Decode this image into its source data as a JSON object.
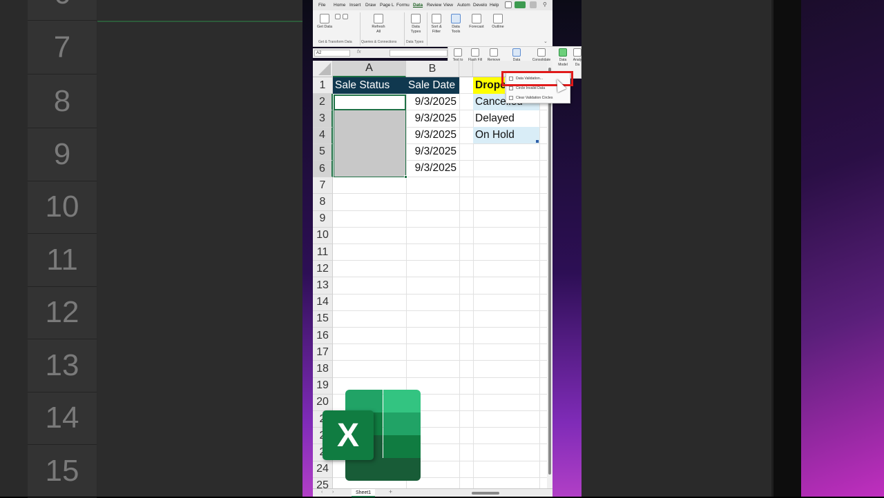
{
  "ribbon": {
    "tabs": [
      "File",
      "Home",
      "Insert",
      "Draw",
      "Page L",
      "Formu",
      "Data",
      "Review",
      "View",
      "Autom",
      "Develo",
      "Help"
    ],
    "active_tab": "Data",
    "buttons": {
      "get_data": "Get Data",
      "refresh_all": "Refresh All",
      "data_types": "Data Types",
      "sort_filter": "Sort & Filter",
      "data_tools": "Data Tools",
      "forecast": "Forecast",
      "outline": "Outline"
    },
    "groups": [
      "Get & Transform Data",
      "Queries & Connections",
      "Data Types"
    ]
  },
  "formula_bar": {
    "name_box": "A2",
    "fx": "fx"
  },
  "data_tools": {
    "text_to_columns": "Text to Columns",
    "flash_fill": "Flash Fill",
    "remove_duplicates": "Remove Duplicates",
    "data_validation": "Data Validation",
    "consolidate": "Consolidate",
    "data_model": "Data Model",
    "analysis": "Analy Da"
  },
  "dropdown_menu": {
    "items": [
      "Data Validation...",
      "Circle Invalid Data",
      "Clear Validation Circles"
    ],
    "highlighted": "Data Validation..."
  },
  "grid": {
    "columns": [
      "A",
      "B"
    ],
    "row_numbers": [
      "1",
      "2",
      "3",
      "4",
      "5",
      "6",
      "7",
      "8",
      "9",
      "10",
      "11",
      "12",
      "13",
      "14",
      "15",
      "16",
      "17",
      "18",
      "19",
      "20",
      "2",
      "2",
      "2",
      "24",
      "25"
    ],
    "headers": {
      "a1": "Sale Status",
      "b1": "Sale Date",
      "d1": "Drope"
    },
    "dates": [
      "9/3/2025",
      "9/3/2025",
      "9/3/2025",
      "9/3/2025",
      "9/3/2025"
    ],
    "dropdown_values": [
      "Cancelled",
      "Delayed",
      "On Hold"
    ]
  },
  "sheet_tabs": {
    "active": "Sheet1",
    "add": "+"
  },
  "background": {
    "row_numbers": [
      "6",
      "7",
      "8",
      "9",
      "10",
      "11",
      "12",
      "13",
      "14",
      "15"
    ]
  },
  "logo": {
    "letter": "X",
    "brand_color": "#107c41"
  },
  "colors": {
    "header_fill": "#10384f",
    "highlight_yellow": "#ffff00",
    "dropdown_fill": "#d9edf7",
    "callout_red": "#e01a1a",
    "selection_green": "#1e7145"
  }
}
